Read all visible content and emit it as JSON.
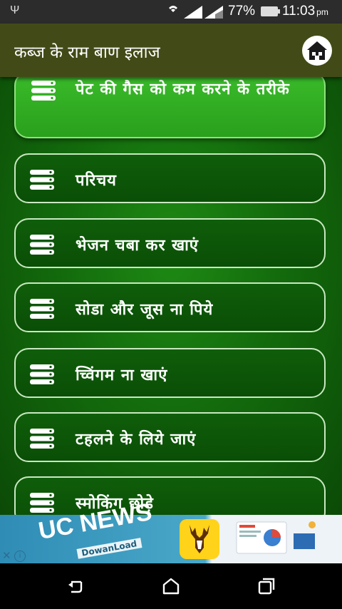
{
  "status_bar": {
    "battery": "77%",
    "time": "11:03",
    "ampm": "pm"
  },
  "app_bar": {
    "title": "कब्ज के राम बाण इलाज"
  },
  "menu": {
    "items": [
      {
        "label": "पेट की गैस को कम करने के तरीके"
      },
      {
        "label": "परिचय"
      },
      {
        "label": "भेजन चबा कर खाएं"
      },
      {
        "label": "सोडा और जूस ना पिये"
      },
      {
        "label": "च्विंगम ना खाएं"
      },
      {
        "label": "टहलने के लिये जाएं"
      },
      {
        "label": "स्मोकिंग छोड़े"
      }
    ]
  },
  "ad": {
    "brand": "UC NEWS",
    "tagline": "DowanLoad"
  },
  "colors": {
    "app_bar": "#424b17",
    "active_item": "#2aa01c",
    "item_bg": "#0a4e06",
    "item_border": "#c9e8c1"
  }
}
